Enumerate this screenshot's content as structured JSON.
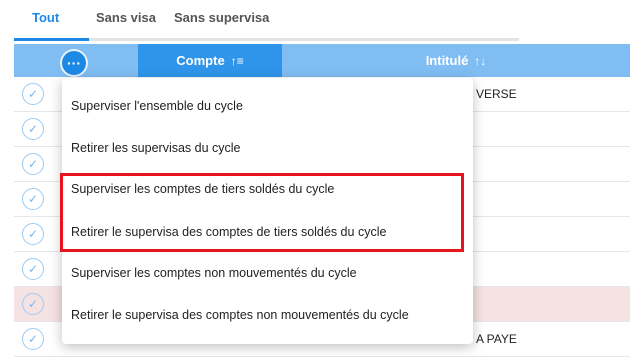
{
  "tabs": [
    {
      "label": "Tout",
      "active": true
    },
    {
      "label": "Sans visa",
      "active": false
    },
    {
      "label": "Sans supervisa",
      "active": false
    }
  ],
  "table": {
    "columns": {
      "compte": "Compte",
      "intitule": "Intitulé"
    },
    "row_texts": [
      "VERSE",
      "",
      "",
      "",
      "",
      "",
      "",
      "A PAYE"
    ]
  },
  "menu": {
    "button_label": "···",
    "items": [
      "Superviser l'ensemble du cycle",
      "Retirer les supervisas du cycle",
      "Superviser les comptes de tiers soldés du cycle",
      "Retirer le supervisa des comptes de tiers soldés du cycle",
      "Superviser les comptes non mouvementés du cycle",
      "Retirer le supervisa des comptes non mouvementés du cycle"
    ]
  },
  "colors": {
    "accent": "#1e88e5",
    "highlight": "#e8141c"
  }
}
